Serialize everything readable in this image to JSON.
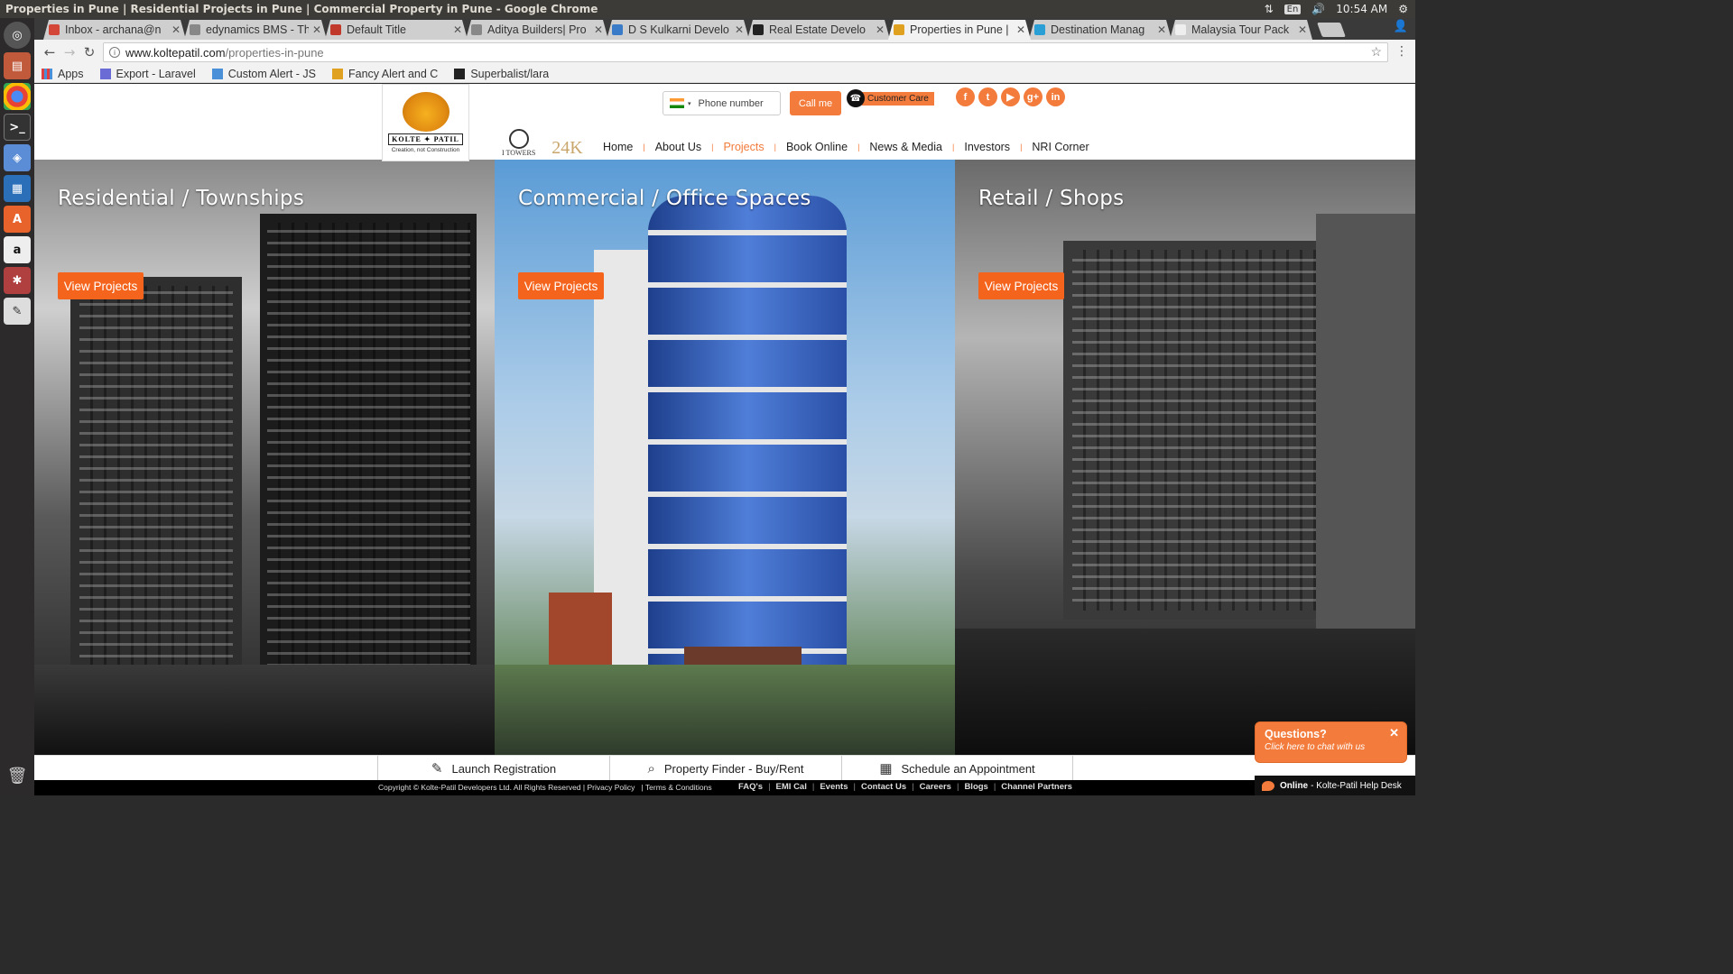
{
  "window": {
    "title": "Properties in Pune | Residential Projects in Pune | Commercial Property in Pune - Google Chrome"
  },
  "tray": {
    "lang": "En",
    "time": "10:54 AM"
  },
  "launcher": {
    "icons": [
      "dash-icon",
      "files-icon",
      "chrome-icon",
      "terminal-icon",
      "box-icon",
      "writer-icon",
      "software-center-icon",
      "amazon-icon",
      "settings-icon",
      "text-editor-icon"
    ],
    "trash_icon": "trash-icon"
  },
  "tabs": [
    {
      "label": "Inbox - archana@n",
      "color": "#d44638"
    },
    {
      "label": "edynamics BMS - Th",
      "color": "#888888"
    },
    {
      "label": "Default Title",
      "color": "#c0392b"
    },
    {
      "label": "Aditya Builders| Pro",
      "color": "#888888"
    },
    {
      "label": "D S Kulkarni Develo",
      "color": "#3a7bc8"
    },
    {
      "label": "Real Estate Develo",
      "color": "#222222"
    },
    {
      "label": "Properties in Pune |",
      "color": "#e0a020",
      "active": true
    },
    {
      "label": "Destination Manag",
      "color": "#2a9fd6"
    },
    {
      "label": "Malaysia Tour Pack",
      "color": "#eeeeee"
    }
  ],
  "address": {
    "domain": "www.koltepatil.com",
    "path": "/properties-in-pune"
  },
  "bookmarks": [
    {
      "label": "Apps"
    },
    {
      "label": "Export - Laravel"
    },
    {
      "label": "Custom Alert - JS"
    },
    {
      "label": "Fancy Alert and C"
    },
    {
      "label": "Superbalist/lara"
    }
  ],
  "header": {
    "logo_brand": "KOLTE ✦ PATIL",
    "logo_tagline": "Creation, not Construction",
    "phone_placeholder": "Phone number",
    "call_label": "Call me",
    "care_label": "Customer Care",
    "social": [
      "f",
      "t",
      "▶",
      "g+",
      "in"
    ],
    "itowers_label": "I TOWERS",
    "k24_label": "24K"
  },
  "nav": [
    "Home",
    "About Us",
    "Projects",
    "Book Online",
    "News & Media",
    "Investors",
    "NRI Corner"
  ],
  "nav_active": "Projects",
  "panels": [
    {
      "title": "Residential / Townships",
      "button": "View Projects"
    },
    {
      "title": "Commercial / Office Spaces",
      "button": "View Projects"
    },
    {
      "title": "Retail / Shops",
      "button": "View Projects"
    }
  ],
  "footer_actions": [
    {
      "label": "Launch Registration",
      "icon": "edit-icon"
    },
    {
      "label": "Property Finder - Buy/Rent",
      "icon": "search-icon"
    },
    {
      "label": "Schedule an Appointment",
      "icon": "calendar-icon"
    }
  ],
  "copyright": {
    "text": "Copyright © Kolte-Patil Developers Ltd. All Rights Reserved",
    "privacy": "Privacy Policy",
    "terms": "Terms & Conditions"
  },
  "footer_links": [
    "FAQ's",
    "EMI Cal",
    "Events",
    "Contact Us",
    "Careers",
    "Blogs",
    "Channel Partners"
  ],
  "chat": {
    "title": "Questions?",
    "subtitle": "Click here to chat with us",
    "online": "Online",
    "desk": "- Kolte-Patil Help Desk"
  },
  "colors": {
    "accent": "#f37b3b",
    "button": "#f4641d"
  }
}
